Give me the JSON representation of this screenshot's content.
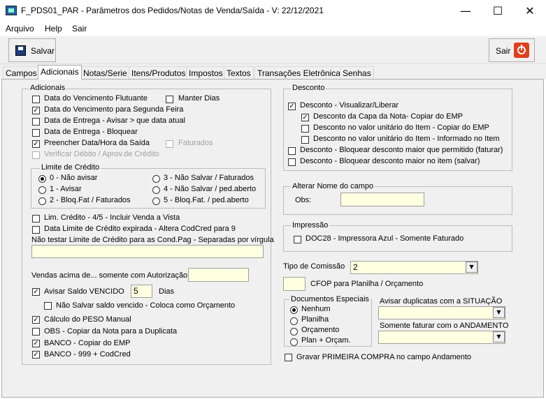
{
  "window": {
    "title": "F_PDS01_PAR - Parâmetros dos Pedidos/Notas de Venda/Saída - V: 22/12/2021",
    "minimize": "—",
    "maximize": "☐",
    "close": "✕"
  },
  "menu": [
    "Arquivo",
    "Help",
    "Sair"
  ],
  "toolbar": {
    "save_label": "Salvar",
    "exit_label": "Sair"
  },
  "tabs": [
    "Campos",
    "Adicionais",
    "Notas/Serie",
    "Itens/Produtos",
    "Impostos",
    "Textos",
    "Transações Eletrônicas",
    "Senhas"
  ],
  "adicionais": {
    "title": "Adicionais",
    "data_venc_flutuante": "Data do Vencimento Flutuante",
    "manter_dias": "Manter Dias",
    "data_venc_segunda": "Data do Vencimento para Segunda Feira",
    "data_entrega_avisar": "Data de Entrega - Avisar > que data atual",
    "data_entrega_bloquear": "Data de Entrega - Bloquear",
    "preencher_data_saida": "Preencher Data/Hora da Saída",
    "faturados": "Faturados",
    "verificar_debito": "Verificar Débito / Aprov.de Crédito",
    "limite_credito": {
      "title": "Limite de Crédito",
      "options": [
        "0 - Não avisar",
        "1 - Avisar",
        "2 - Bloq.Fat / Faturados",
        "3 - Não Salvar / Faturados",
        "4 - Não Salvar / ped.aberto",
        "5 - Bloq.Fat. / ped.aberto"
      ]
    },
    "lim_credito_45": "Lim. Crédito - 4/5 - Incluir Venda a Vista",
    "data_limite_expirada": "Data Limite de Crédito expirada - Altera CodCred para 9",
    "nao_testar_label": "Não testar Limite de Crédito para as Cond.Pag - Separadas por vírgula",
    "nao_testar_value": "",
    "vendas_acima_label": "Vendas acima de... somente com Autorização",
    "vendas_acima_value": "",
    "avisar_saldo": "Avisar Saldo VENCIDO",
    "avisar_saldo_dias_value": "5",
    "dias": "Dias",
    "nao_salvar_saldo": "Não Salvar saldo vencido - Coloca como Orçamento",
    "calculo_peso": "Cálculo do PESO Manual",
    "obs_copiar": "OBS - Copiar da Nota para a Duplicata",
    "banco_copiar": "BANCO - Copiar do EMP",
    "banco_999": "BANCO - 999 + CodCred"
  },
  "desconto": {
    "title": "Desconto",
    "visualizar": "Desconto - Visualizar/Liberar",
    "capa_nota": "Desconto da Capa da Nota- Copiar do EMP",
    "valor_unit_copiar": "Desconto no valor unitário do Item - Copiar do EMP",
    "valor_unit_informado": "Desconto no valor unitário do Item - Informado no Item",
    "bloquear_faturar": "Desconto - Bloquear desconto maior que permitido (faturar)",
    "bloquear_salvar": "Desconto - Bloquear desconto maior no item (salvar)"
  },
  "alterar_nome": {
    "title": "Alterar Nome do campo",
    "obs_label": "Obs:",
    "obs_value": ""
  },
  "impressao": {
    "title": "Impressão",
    "doc28": "DOC28 - Impressora Azul - Somente Faturado"
  },
  "tipo_comissao": {
    "label": "Tipo de Comissão",
    "value": "2"
  },
  "cfop": {
    "label": "CFOP para Planilha / Orçamento",
    "value": ""
  },
  "documentos_especiais": {
    "title": "Documentos Especiais",
    "options": [
      "Nenhum",
      "Planilha",
      "Orçamento",
      "Plan + Orçam."
    ]
  },
  "avisar_duplicatas": {
    "label": "Avisar duplicatas com a SITUAÇÃO",
    "value": ""
  },
  "somente_faturar": {
    "label": "Somente faturar com o ANDAMENTO",
    "value": ""
  },
  "gravar_primeira_compra": "Gravar PRIMEIRA COMPRA no campo Andamento",
  "colors": {
    "input_bg": "#ffffe1",
    "panel_bg": "#f0f0f0",
    "exit_icon": "#e0401a"
  }
}
